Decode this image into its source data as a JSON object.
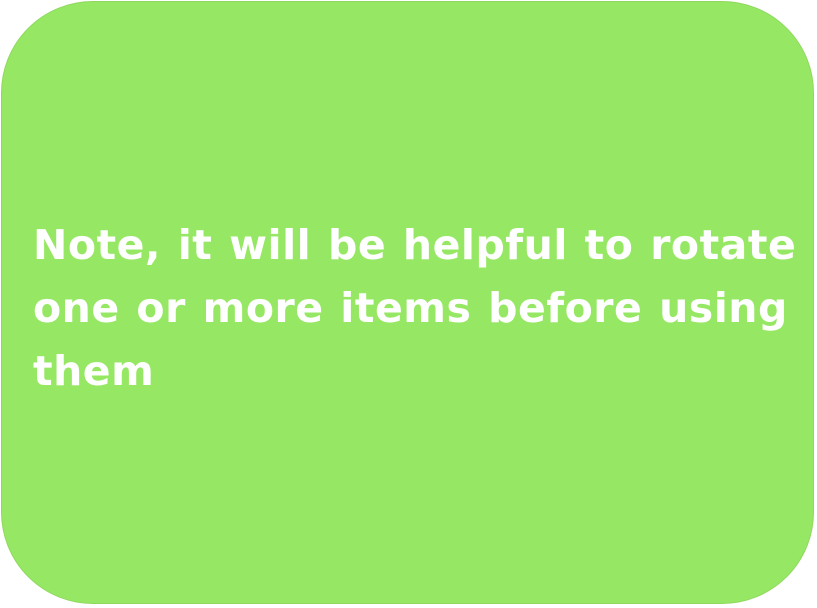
{
  "note": {
    "lines": [
      "Note, it will be helpful to rotate",
      "one or more items before using",
      "them"
    ]
  },
  "colors": {
    "card_background": "#96e864",
    "text": "#ffffff"
  }
}
